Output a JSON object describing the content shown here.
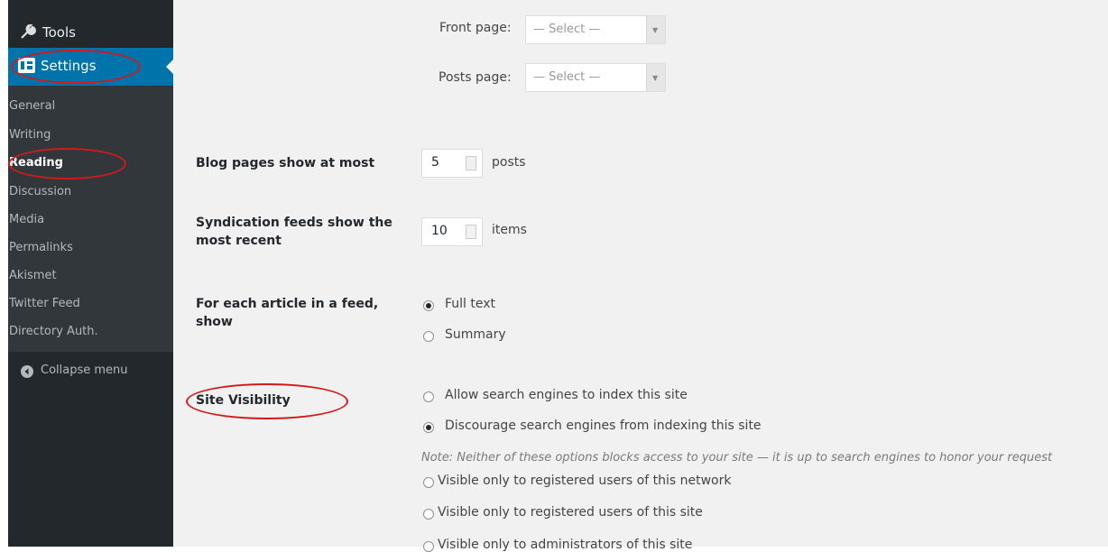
{
  "sidebar": {
    "tools_label": "Tools",
    "settings_label": "Settings",
    "submenu": [
      "General",
      "Writing",
      "Reading",
      "Discussion",
      "Media",
      "Permalinks",
      "Akismet",
      "Twitter Feed",
      "Directory Auth."
    ],
    "collapse_label": "Collapse menu"
  },
  "main": {
    "front_page": {
      "label": "Front page:",
      "value": "— Select —"
    },
    "posts_page": {
      "label": "Posts page:",
      "value": "— Select —"
    },
    "blog_pages": {
      "label": "Blog pages show at most",
      "value": "5",
      "unit": "posts"
    },
    "syndication": {
      "label_line1": "Syndication feeds show the",
      "label_line2": "most recent",
      "value": "10",
      "unit": "items"
    },
    "feed_article": {
      "label_line1": "For each article in a feed,",
      "label_line2": "show",
      "options": [
        "Full text",
        "Summary"
      ],
      "selected": "Full text"
    },
    "site_visibility": {
      "label": "Site Visibility",
      "options": [
        "Allow search engines to index this site",
        "Discourage search engines from indexing this site"
      ],
      "selected": "Discourage search engines from indexing this site",
      "note": "Note: Neither of these options blocks access to your site — it is up to search engines to honor your request",
      "more_options": [
        "Visible only to registered users of this network",
        "Visible only to registered users of this site",
        "Visible only to administrators of this site"
      ]
    }
  },
  "colors": {
    "sidebar_bg": "#23282d",
    "submenu_bg": "#32373c",
    "accent": "#0073aa",
    "annotation": "#d21a1a",
    "content_bg": "#f1f1f1"
  }
}
